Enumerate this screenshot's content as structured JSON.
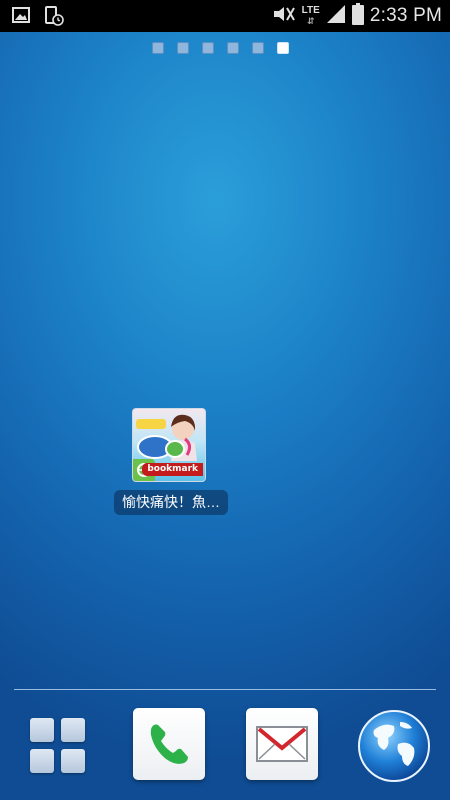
{
  "status_bar": {
    "time": "2:33 PM",
    "network": "LTE",
    "network_arrows": "⇵",
    "icons_left": [
      "gallery-notification-icon",
      "screenshot-notification-icon"
    ],
    "icons_right": [
      "vibrate-mute-icon",
      "signal-icon",
      "battery-icon"
    ]
  },
  "home": {
    "page_count": 6,
    "active_page": 6,
    "shortcut": {
      "label": "愉快痛快！魚…",
      "icon_name": "bookmark-shortcut-icon",
      "badge_text": "bookmark"
    }
  },
  "dock": {
    "items": [
      {
        "name": "apps-button",
        "icon": "apps-grid-icon"
      },
      {
        "name": "phone-button",
        "icon": "phone-icon"
      },
      {
        "name": "email-button",
        "icon": "email-icon"
      },
      {
        "name": "internet-button",
        "icon": "globe-icon"
      }
    ]
  },
  "colors": {
    "wallpaper_center": "#2b9fd9",
    "wallpaper_edge": "#0f4c93",
    "phone_green": "#2db24a",
    "email_red": "#d3252c"
  }
}
